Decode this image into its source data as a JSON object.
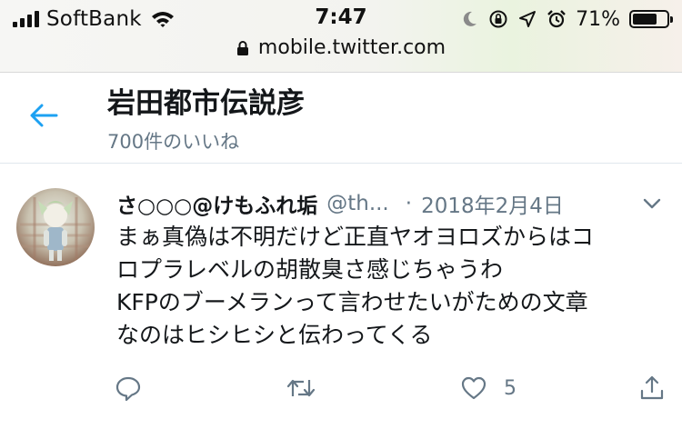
{
  "status_bar": {
    "carrier": "SoftBank",
    "time": "7:47",
    "battery_percent": "71%",
    "battery_level": 0.71,
    "url": "mobile.twitter.com"
  },
  "header": {
    "title": "岩田都市伝説彦",
    "subtitle": "700件のいいね"
  },
  "tweet": {
    "author": "さ○○○@けもふれ垢",
    "handle": "@th...",
    "separator": "·",
    "date": "2018年2月4日",
    "lines": [
      "まぁ真偽は不明だけど正直ヤオヨロズからはコ",
      "ロプラレベルの胡散臭さ感じちゃうわ",
      "KFPのブーメランって言わせたいがための文章",
      "なのはヒシヒシと伝わってくる"
    ],
    "like_count": "5"
  },
  "colors": {
    "accent": "#1da1f2",
    "text": "#14171a",
    "secondary": "#657786",
    "icon": "#657786"
  },
  "icons": {
    "back": "arrow-left-icon",
    "reply": "reply-icon",
    "retweet": "retweet-icon",
    "like": "heart-icon",
    "share": "share-icon",
    "caret": "chevron-down-icon"
  }
}
